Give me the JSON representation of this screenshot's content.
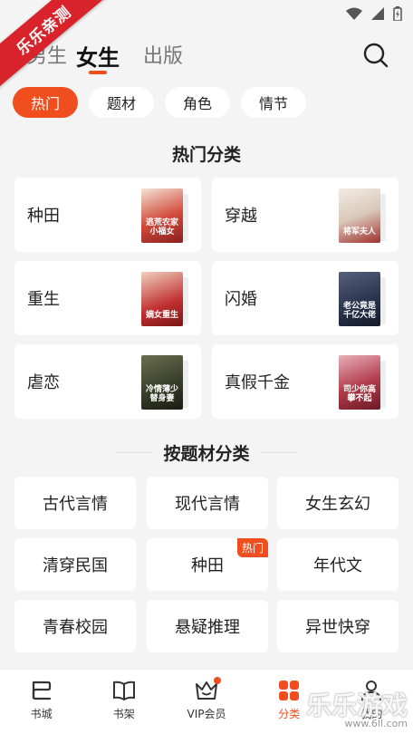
{
  "ribbon": "乐乐亲测",
  "topnav": {
    "tabs": [
      "男生",
      "女生",
      "出版"
    ],
    "active_index": 1
  },
  "pills": [
    "热门",
    "题材",
    "角色",
    "情节"
  ],
  "hot_section": {
    "title": "热门分类",
    "items": [
      {
        "label": "种田",
        "cover_text": "逃荒农家小福女",
        "cover_color": "#c23a3a"
      },
      {
        "label": "穿越",
        "cover_text": "将军夫人",
        "cover_color": "#d9d2c8"
      },
      {
        "label": "重生",
        "cover_text": "嫡女重生",
        "cover_color": "#b02a2a"
      },
      {
        "label": "闪婚",
        "cover_text": "老公竟是千亿大佬",
        "cover_color": "#2b3550"
      },
      {
        "label": "虐恋",
        "cover_text": "冷情薄少替身妻",
        "cover_color": "#3a3f2a"
      },
      {
        "label": "真假千金",
        "cover_text": "司少你高攀不起",
        "cover_color": "#b23a4a"
      }
    ]
  },
  "topic_section": {
    "title": "按题材分类",
    "items": [
      {
        "label": "古代言情",
        "badge": ""
      },
      {
        "label": "现代言情",
        "badge": ""
      },
      {
        "label": "女生玄幻",
        "badge": ""
      },
      {
        "label": "清穿民国",
        "badge": ""
      },
      {
        "label": "种田",
        "badge": "热门"
      },
      {
        "label": "年代文",
        "badge": ""
      },
      {
        "label": "青春校园",
        "badge": ""
      },
      {
        "label": "悬疑推理",
        "badge": ""
      },
      {
        "label": "异世快穿",
        "badge": ""
      }
    ]
  },
  "bottom_nav": [
    {
      "label": "书城",
      "icon": "bookstore-icon"
    },
    {
      "label": "书架",
      "icon": "bookshelf-icon"
    },
    {
      "label": "VIP会员",
      "icon": "vip-crown-icon"
    },
    {
      "label": "分类",
      "icon": "category-icon"
    },
    {
      "label": "我的",
      "icon": "profile-icon"
    }
  ],
  "watermark": {
    "main": "乐乐游戏",
    "sub": "www.6ll.com"
  },
  "colors": {
    "accent": "#f04e1f",
    "background": "#f4f4f4"
  }
}
